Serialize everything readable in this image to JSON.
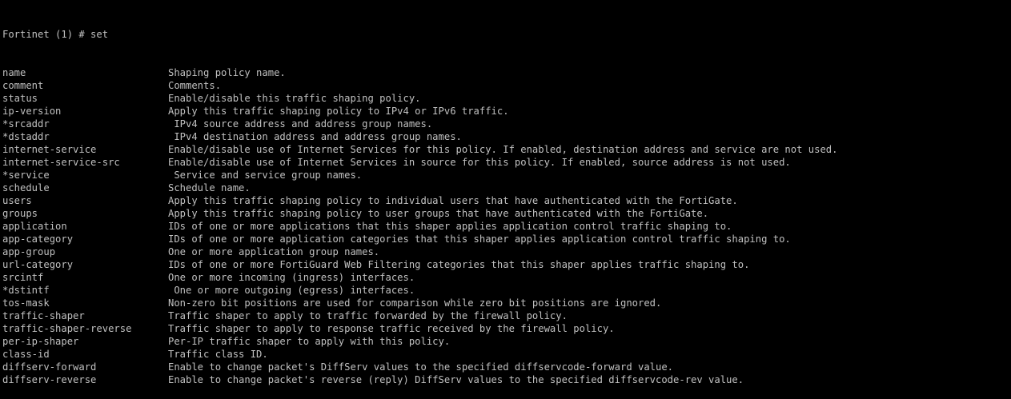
{
  "prompt": "Fortinet (1) # set",
  "rows": [
    {
      "cmd": "name",
      "desc": "Shaping policy name."
    },
    {
      "cmd": "comment",
      "desc": "Comments."
    },
    {
      "cmd": "status",
      "desc": "Enable/disable this traffic shaping policy."
    },
    {
      "cmd": "ip-version",
      "desc": "Apply this traffic shaping policy to IPv4 or IPv6 traffic."
    },
    {
      "cmd": "*srcaddr",
      "desc": " IPv4 source address and address group names."
    },
    {
      "cmd": "*dstaddr",
      "desc": " IPv4 destination address and address group names."
    },
    {
      "cmd": "internet-service",
      "desc": "Enable/disable use of Internet Services for this policy. If enabled, destination address and service are not used."
    },
    {
      "cmd": "internet-service-src",
      "desc": "Enable/disable use of Internet Services in source for this policy. If enabled, source address is not used."
    },
    {
      "cmd": "*service",
      "desc": " Service and service group names."
    },
    {
      "cmd": "schedule",
      "desc": "Schedule name."
    },
    {
      "cmd": "users",
      "desc": "Apply this traffic shaping policy to individual users that have authenticated with the FortiGate."
    },
    {
      "cmd": "groups",
      "desc": "Apply this traffic shaping policy to user groups that have authenticated with the FortiGate."
    },
    {
      "cmd": "application",
      "desc": "IDs of one or more applications that this shaper applies application control traffic shaping to."
    },
    {
      "cmd": "app-category",
      "desc": "IDs of one or more application categories that this shaper applies application control traffic shaping to."
    },
    {
      "cmd": "app-group",
      "desc": "One or more application group names."
    },
    {
      "cmd": "url-category",
      "desc": "IDs of one or more FortiGuard Web Filtering categories that this shaper applies traffic shaping to."
    },
    {
      "cmd": "srcintf",
      "desc": "One or more incoming (ingress) interfaces."
    },
    {
      "cmd": "*dstintf",
      "desc": " One or more outgoing (egress) interfaces."
    },
    {
      "cmd": "tos-mask",
      "desc": "Non-zero bit positions are used for comparison while zero bit positions are ignored."
    },
    {
      "cmd": "traffic-shaper",
      "desc": "Traffic shaper to apply to traffic forwarded by the firewall policy."
    },
    {
      "cmd": "traffic-shaper-reverse",
      "desc": "Traffic shaper to apply to response traffic received by the firewall policy."
    },
    {
      "cmd": "per-ip-shaper",
      "desc": "Per-IP traffic shaper to apply with this policy."
    },
    {
      "cmd": "class-id",
      "desc": "Traffic class ID."
    },
    {
      "cmd": "diffserv-forward",
      "desc": "Enable to change packet's DiffServ values to the specified diffservcode-forward value."
    },
    {
      "cmd": "diffserv-reverse",
      "desc": "Enable to change packet's reverse (reply) DiffServ values to the specified diffservcode-rev value."
    }
  ],
  "colors": {
    "background": "#000000",
    "foreground": "#c0c0c0"
  }
}
